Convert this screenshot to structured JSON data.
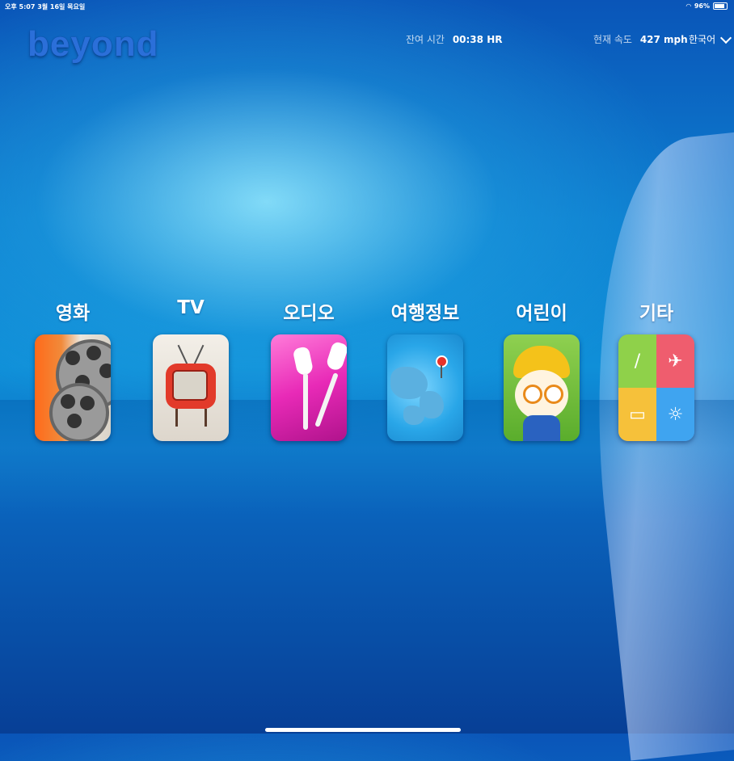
{
  "status_bar": {
    "left": "오후 5:07  3월 16일 목요일",
    "right": "96%"
  },
  "header": {
    "logo": "beyond",
    "time_remaining_label": "잔여 시간",
    "time_remaining_value": "00:38 HR",
    "speed_label": "현재 속도",
    "speed_value": "427 mph",
    "language": "한국어"
  },
  "menu": [
    {
      "label": "영화",
      "icon": "film-reel-icon"
    },
    {
      "label": "TV",
      "icon": "retro-tv-icon"
    },
    {
      "label": "오디오",
      "icon": "earphones-icon"
    },
    {
      "label": "여행정보",
      "icon": "map-pin-icon"
    },
    {
      "label": "어린이",
      "icon": "pororo-character-icon"
    },
    {
      "label": "기타",
      "icon": "misc-grid-icon"
    }
  ],
  "colors": {
    "accent": "#2b6fd9",
    "background": "#0d7fd0"
  }
}
